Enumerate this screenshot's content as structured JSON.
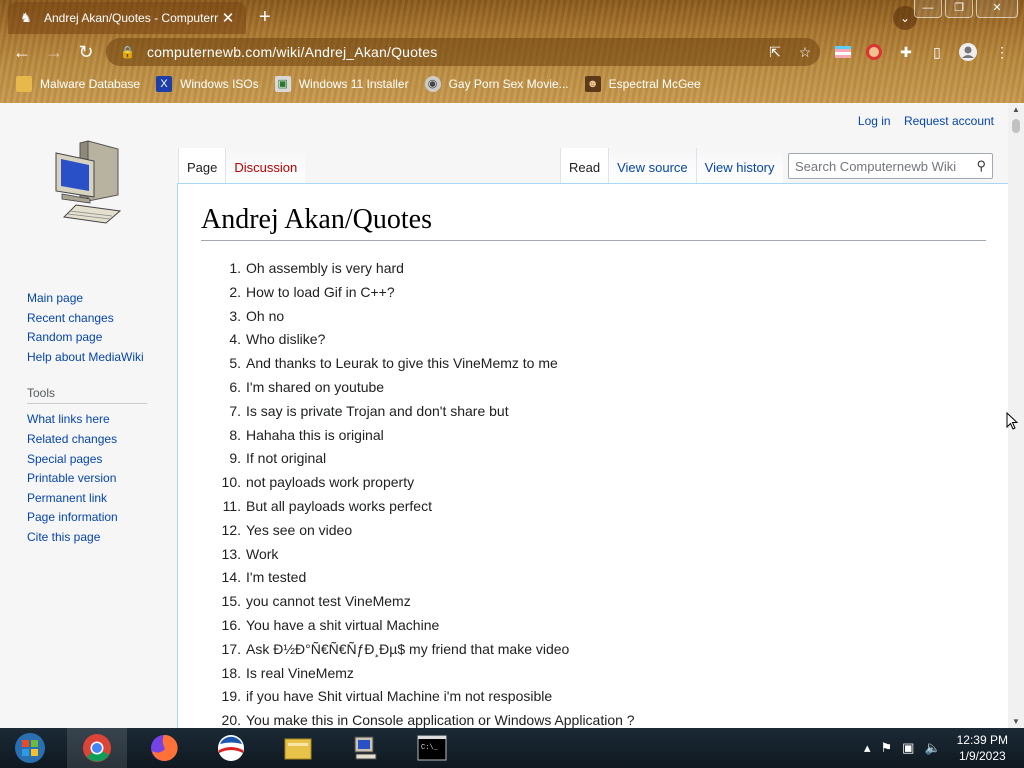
{
  "browser": {
    "tab_title": "Andrej Akan/Quotes - Computerr",
    "tab_close": "✕",
    "new_tab": "+",
    "url": "computernewb.com/wiki/Andrej_Akan/Quotes",
    "window_controls": [
      "—",
      "❐",
      "✕"
    ],
    "bookmarks": [
      {
        "label": "Malware Database",
        "icon": "malware-icon",
        "color": "#e6b94a"
      },
      {
        "label": "Windows ISOs",
        "icon": "x-icon",
        "color": "#1d3ea8"
      },
      {
        "label": "Windows 11 Installer",
        "icon": "image-icon",
        "color": "#d9d9d9"
      },
      {
        "label": "Gay Porn Sex Movie...",
        "icon": "disc-icon",
        "color": "#cccccc"
      },
      {
        "label": "Espectral McGee",
        "icon": "character-icon",
        "color": "#5b3a1a"
      }
    ]
  },
  "wiki": {
    "user_links": [
      "Log in",
      "Request account"
    ],
    "left_tabs": [
      "Page",
      "Discussion"
    ],
    "right_tabs": [
      "Read",
      "View source",
      "View history"
    ],
    "search_placeholder": "Search Computernewb Wiki",
    "nav": [
      "Main page",
      "Recent changes",
      "Random page",
      "Help about MediaWiki"
    ],
    "tools_heading": "Tools",
    "tools": [
      "What links here",
      "Related changes",
      "Special pages",
      "Printable version",
      "Permanent link",
      "Page information",
      "Cite this page"
    ],
    "page_title": "Andrej Akan/Quotes",
    "quotes": [
      "Oh assembly is very hard",
      "How to load Gif in C++?",
      "Oh no",
      "Who dislike?",
      "And thanks to Leurak to give this VineMemz to me",
      "I'm shared on youtube",
      "Is say is private Trojan and don't share but",
      "Hahaha this is original",
      "If not original",
      "not payloads work property",
      "But all payloads works perfect",
      "Yes see on video",
      "Work",
      "I'm tested",
      "you cannot test VineMemz",
      "You have a shit virtual Machine",
      "Ask Ð½Ð°Ñ€Ñ€ÑƒÐ¸Ðµ$ my friend that make video",
      "Is real VineMemz",
      "if you have Shit virtual Machine i'm not resposible",
      "You make this in Console application or Windows Application ?"
    ]
  },
  "taskbar": {
    "time": "12:39 PM",
    "date": "1/9/2023"
  }
}
